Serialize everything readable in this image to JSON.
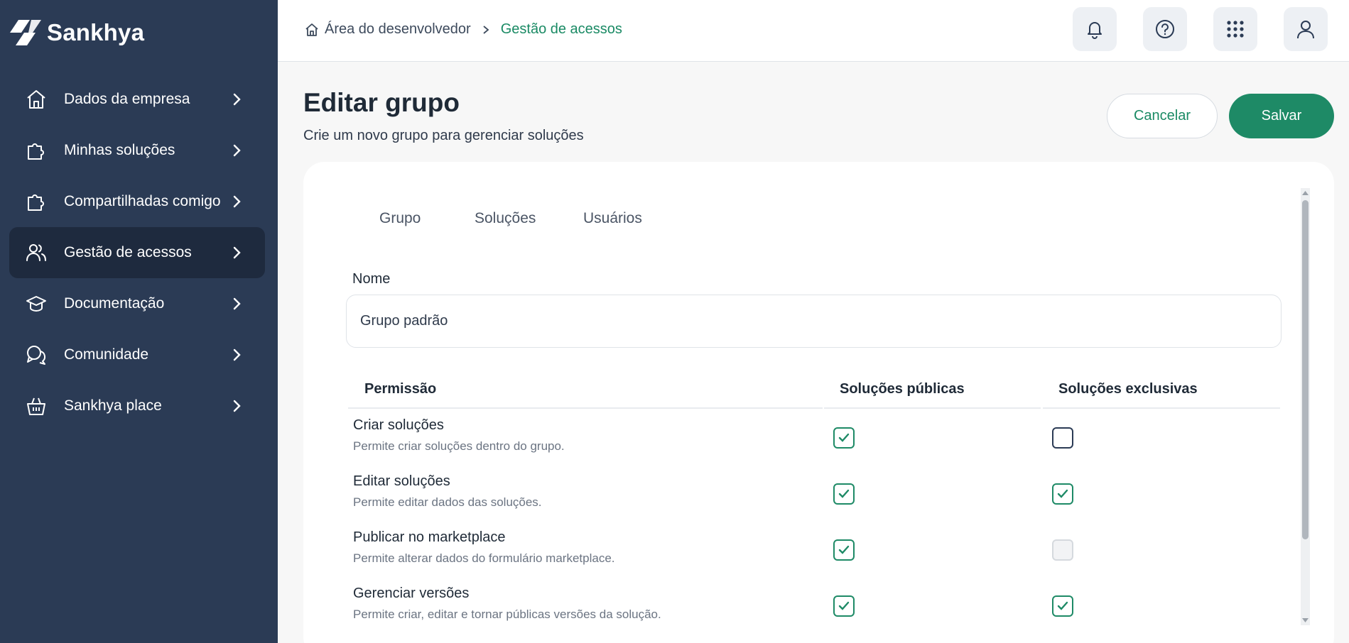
{
  "app": {
    "logo_text": "Sankhya"
  },
  "sidebar": {
    "items": [
      {
        "label": "Dados da empresa",
        "icon": "home-icon"
      },
      {
        "label": "Minhas soluções",
        "icon": "puzzle-icon"
      },
      {
        "label": "Compartilhadas comigo",
        "icon": "puzzle-icon"
      },
      {
        "label": "Gestão de acessos",
        "icon": "users-icon",
        "active": true
      },
      {
        "label": "Documentação",
        "icon": "graduation-cap-icon"
      },
      {
        "label": "Comunidade",
        "icon": "chat-bubbles-icon"
      },
      {
        "label": "Sankhya place",
        "icon": "basket-icon"
      }
    ]
  },
  "breadcrumb": {
    "home": "Área do desenvolvedor",
    "current": "Gestão de acessos"
  },
  "topbar": {
    "icons": [
      "bell-icon",
      "help-icon",
      "apps-grid-icon",
      "user-icon"
    ]
  },
  "header": {
    "title": "Editar grupo",
    "subtitle": "Crie um novo grupo para gerenciar soluções",
    "cancel_label": "Cancelar",
    "save_label": "Salvar"
  },
  "tabs": [
    "Grupo",
    "Soluções",
    "Usuários"
  ],
  "form": {
    "name_label": "Nome",
    "name_value": "Grupo padrão"
  },
  "permissions_table": {
    "columns": [
      "Permissão",
      "Soluções públicas",
      "Soluções exclusivas"
    ],
    "rows": [
      {
        "title": "Criar soluções",
        "description": "Permite criar soluções dentro do grupo.",
        "public": "checked",
        "exclusive": "unchecked"
      },
      {
        "title": "Editar soluções",
        "description": "Permite editar dados das soluções.",
        "public": "checked",
        "exclusive": "checked"
      },
      {
        "title": "Publicar no marketplace",
        "description": "Permite alterar dados do formulário marketplace.",
        "public": "checked",
        "exclusive": "disabled"
      },
      {
        "title": "Gerenciar versões",
        "description": "Permite criar, editar e tornar públicas versões da solução.",
        "public": "checked",
        "exclusive": "checked"
      }
    ]
  },
  "colors": {
    "sidebar_bg": "#2b3b55",
    "sidebar_active_bg": "#1e2a3e",
    "accent": "#1e8a66"
  }
}
